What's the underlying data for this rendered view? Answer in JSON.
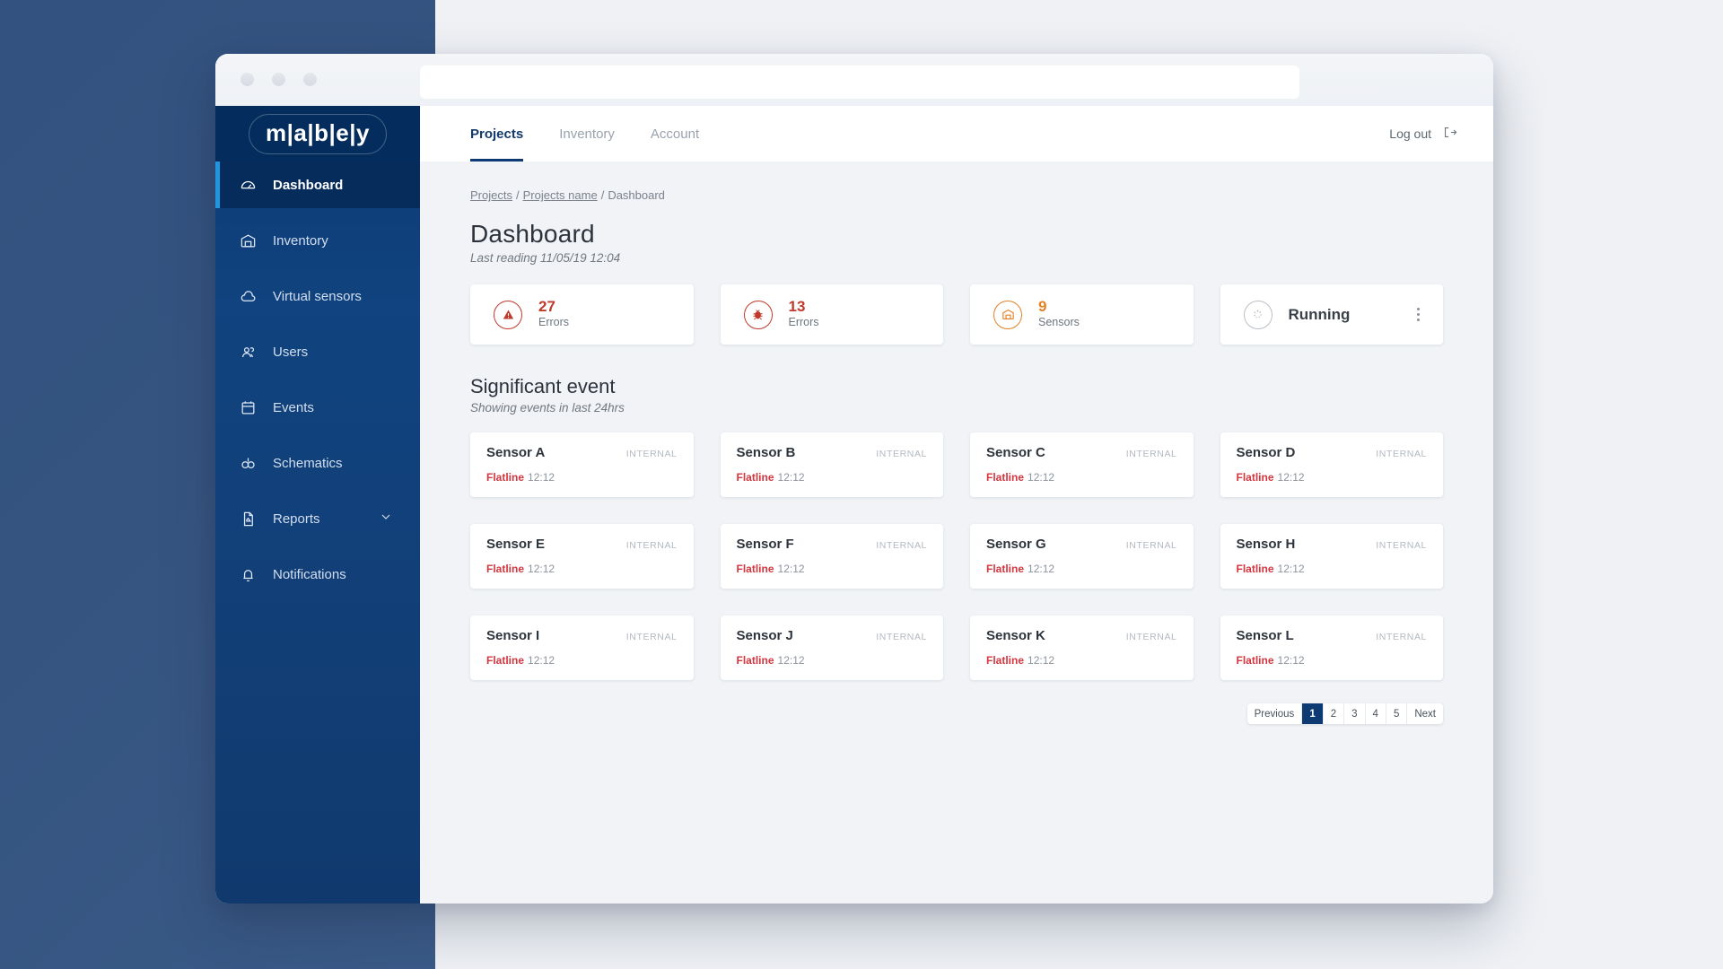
{
  "browser": {
    "dots": [
      "window-dot",
      "window-dot",
      "window-dot"
    ],
    "url_value": "",
    "url_placeholder": ""
  },
  "sidebar": {
    "logo": "m|a|b|e|y",
    "items": [
      {
        "label": "Dashboard",
        "icon": "gauge-icon",
        "active": true,
        "chevron": false
      },
      {
        "label": "Inventory",
        "icon": "warehouse-icon",
        "active": false,
        "chevron": false
      },
      {
        "label": "Virtual sensors",
        "icon": "cloud-icon",
        "active": false,
        "chevron": false
      },
      {
        "label": "Users",
        "icon": "users-icon",
        "active": false,
        "chevron": false
      },
      {
        "label": "Events",
        "icon": "calendar-icon",
        "active": false,
        "chevron": false
      },
      {
        "label": "Schematics",
        "icon": "schematics-icon",
        "active": false,
        "chevron": false
      },
      {
        "label": "Reports",
        "icon": "document-icon",
        "active": false,
        "chevron": true
      },
      {
        "label": "Notifications",
        "icon": "bell-icon",
        "active": false,
        "chevron": false
      }
    ]
  },
  "topbar": {
    "tabs": [
      {
        "label": "Projects",
        "active": true
      },
      {
        "label": "Inventory",
        "active": false
      },
      {
        "label": "Account",
        "active": false
      }
    ],
    "logout_label": "Log out",
    "logout_icon": "logout-icon"
  },
  "breadcrumb": {
    "items": [
      "Projects",
      "Projects name",
      "Dashboard"
    ],
    "separator": "/"
  },
  "page": {
    "title": "Dashboard",
    "subtitle": "Last reading 11/05/19 12:04"
  },
  "stats": [
    {
      "value": "27",
      "label": "Errors",
      "icon": "warning-triangle-icon",
      "color": "#c0392b"
    },
    {
      "value": "13",
      "label": "Errors",
      "icon": "bug-icon",
      "color": "#c0392b"
    },
    {
      "value": "9",
      "label": "Sensors",
      "icon": "warehouse-icon",
      "color": "#e38127"
    }
  ],
  "running_card": {
    "label": "Running",
    "icon": "spinner-icon",
    "menu_icon": "kebab-menu-icon"
  },
  "events_section": {
    "title": "Significant event",
    "subtitle": "Showing events in last 24hrs",
    "cards": [
      {
        "name": "Sensor A",
        "tag": "INTERNAL",
        "status": "Flatline",
        "time": "12:12"
      },
      {
        "name": "Sensor B",
        "tag": "INTERNAL",
        "status": "Flatline",
        "time": "12:12"
      },
      {
        "name": "Sensor C",
        "tag": "INTERNAL",
        "status": "Flatline",
        "time": "12:12"
      },
      {
        "name": "Sensor D",
        "tag": "INTERNAL",
        "status": "Flatline",
        "time": "12:12"
      },
      {
        "name": "Sensor E",
        "tag": "INTERNAL",
        "status": "Flatline",
        "time": "12:12"
      },
      {
        "name": "Sensor F",
        "tag": "INTERNAL",
        "status": "Flatline",
        "time": "12:12"
      },
      {
        "name": "Sensor G",
        "tag": "INTERNAL",
        "status": "Flatline",
        "time": "12:12"
      },
      {
        "name": "Sensor H",
        "tag": "INTERNAL",
        "status": "Flatline",
        "time": "12:12"
      },
      {
        "name": "Sensor I",
        "tag": "INTERNAL",
        "status": "Flatline",
        "time": "12:12"
      },
      {
        "name": "Sensor J",
        "tag": "INTERNAL",
        "status": "Flatline",
        "time": "12:12"
      },
      {
        "name": "Sensor K",
        "tag": "INTERNAL",
        "status": "Flatline",
        "time": "12:12"
      },
      {
        "name": "Sensor L",
        "tag": "INTERNAL",
        "status": "Flatline",
        "time": "12:12"
      }
    ]
  },
  "pagination": {
    "previous_label": "Previous",
    "next_label": "Next",
    "pages": [
      "1",
      "2",
      "3",
      "4",
      "5"
    ],
    "current": "1"
  },
  "colors": {
    "brand_navy": "#0d3a73",
    "accent_blue": "#2196e0",
    "error_red": "#c0392b",
    "flatline_red": "#d4373f",
    "sensor_orange": "#e38127",
    "canvas": "#eff1f5"
  }
}
